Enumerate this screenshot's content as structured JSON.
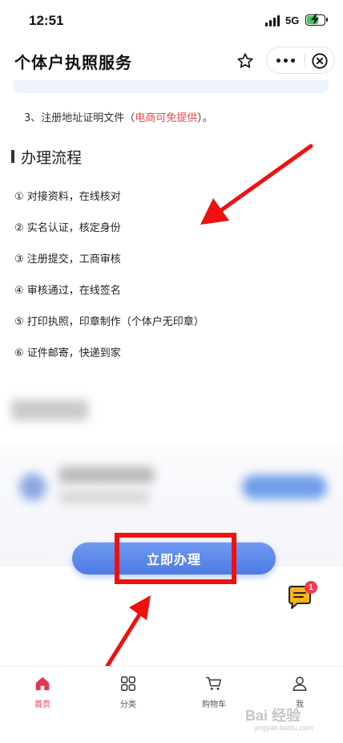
{
  "status_bar": {
    "time": "12:51",
    "network": "5G",
    "battery_level": 0.75,
    "battery_color": "#3ec85a"
  },
  "header": {
    "title": "个体户执照服务",
    "icons": [
      "star-icon",
      "more-icon",
      "close-icon"
    ]
  },
  "content": {
    "note": {
      "prefix": "3、注册地址证明文件（",
      "highlight": "电商可免提供",
      "suffix": "）。",
      "highlight_color": "#e14c4c"
    },
    "section_title": "办理流程",
    "steps": [
      "① 对接资料，在线核对",
      "② 实名认证，核定身份",
      "③ 注册提交，工商审核",
      "④ 审核通过，在线签名",
      "⑤ 打印执照，印章制作（个体户无印章）",
      "⑥ 证件邮寄，快递到家"
    ]
  },
  "cta": {
    "label": "立即办理",
    "color": "#4d7be3"
  },
  "chat": {
    "badge_count": "1",
    "icon": "chat-icon"
  },
  "annotation_color": "#f01010",
  "tab_bar": {
    "active_color": "#e0384e",
    "items": [
      {
        "label": "首页",
        "icon": "home-icon",
        "active": true
      },
      {
        "label": "分类",
        "icon": "category-icon",
        "active": false
      },
      {
        "label": "购物车",
        "icon": "cart-icon",
        "active": false
      },
      {
        "label": "我",
        "icon": "user-icon",
        "active": false
      }
    ]
  },
  "watermark": {
    "text": "Bai 经验",
    "sub": "jingyan.baidu.com"
  }
}
